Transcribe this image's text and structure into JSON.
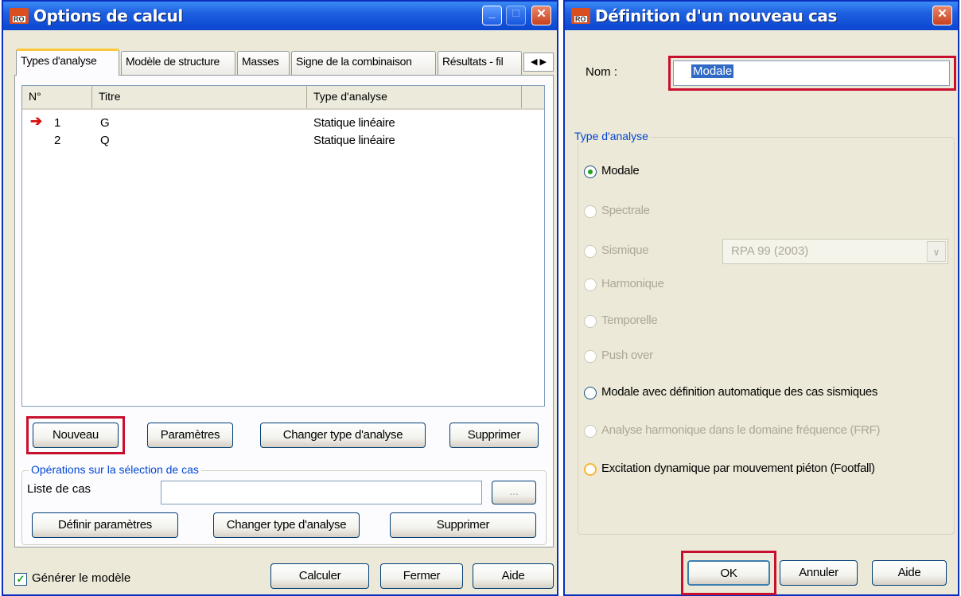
{
  "left_window": {
    "title": "Options de calcul",
    "tabs": [
      "Types d'analyse",
      "Modèle de structure",
      "Masses",
      "Signe de la combinaison",
      "Résultats - fil"
    ],
    "columns": [
      "N°",
      "Titre",
      "Type d'analyse"
    ],
    "rows": [
      {
        "num": "1",
        "title": "G",
        "type": "Statique linéaire",
        "current": true
      },
      {
        "num": "2",
        "title": "Q",
        "type": "Statique linéaire",
        "current": false
      }
    ],
    "buttons": {
      "new": "Nouveau",
      "params": "Paramètres",
      "change": "Changer type d'analyse",
      "delete": "Supprimer"
    },
    "ops_group": {
      "legend": "Opérations sur la sélection de cas",
      "case_list_label": "Liste de cas",
      "case_list_value": "",
      "browse": "...",
      "define": "Définir paramètres",
      "change": "Changer type d'analyse",
      "delete": "Supprimer"
    },
    "generate_model": "Générer le modèle",
    "footer": {
      "calc": "Calculer",
      "close": "Fermer",
      "help": "Aide"
    }
  },
  "right_window": {
    "title": "Définition d'un nouveau cas",
    "name_label": "Nom :",
    "name_value": "Modale",
    "group_label": "Type d'analyse",
    "options": {
      "modal": "Modale",
      "spectral": "Spectrale",
      "seismic": "Sismique",
      "seismic_code": "RPA 99 (2003)",
      "harmonic": "Harmonique",
      "temporal": "Temporelle",
      "pushover": "Push over",
      "modal_auto": "Modale avec définition automatique des cas sismiques",
      "harmonic_frf": "Analyse harmonique dans le domaine fréquence (FRF)",
      "footfall": "Excitation dynamique par mouvement piéton (Footfall)"
    },
    "buttons": {
      "ok": "OK",
      "cancel": "Annuler",
      "help": "Aide"
    }
  },
  "icon_text": "RO",
  "colors": {
    "highlight": "#c8102e",
    "titlebar": "#0b46cf",
    "selection": "#316ac5"
  }
}
